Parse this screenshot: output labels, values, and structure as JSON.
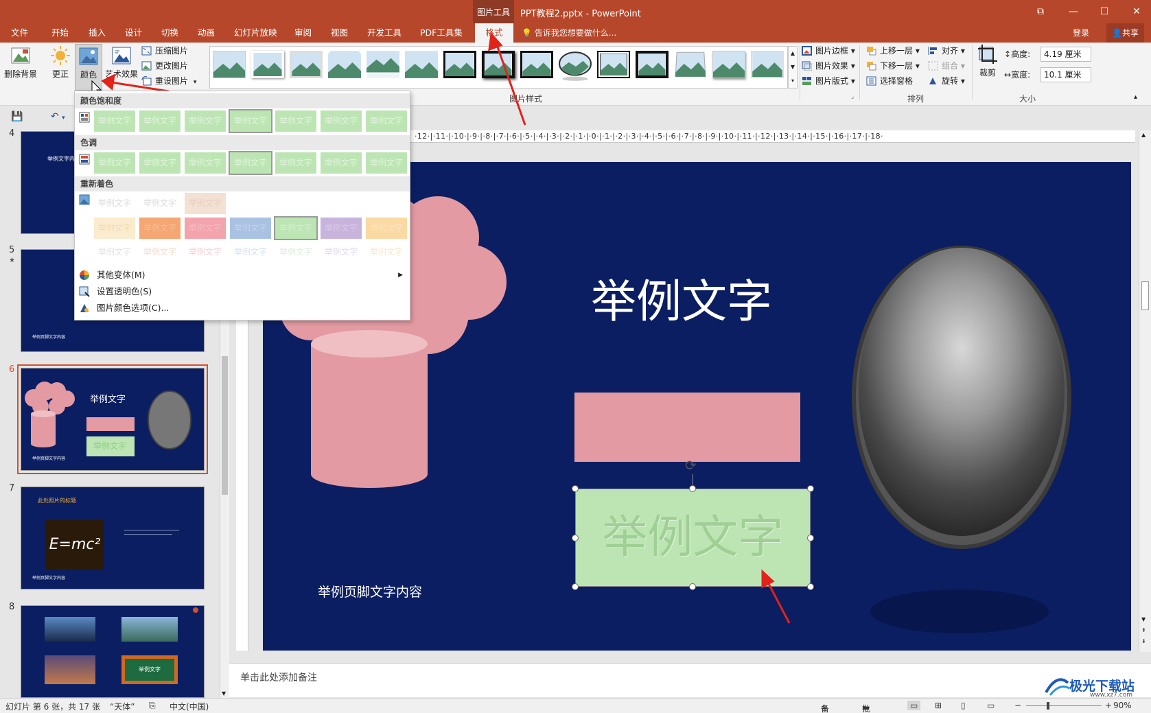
{
  "titlebar": {
    "contextual_group": "图片工具",
    "doc_title": "PPT教程2.pptx - PowerPoint",
    "win_restore": "⧉",
    "win_min": "—",
    "win_max": "☐",
    "win_close": "✕"
  },
  "tabs": [
    "文件",
    "开始",
    "插入",
    "设计",
    "切换",
    "动画",
    "幻灯片放映",
    "审阅",
    "视图",
    "开发工具",
    "PDF工具集",
    "格式"
  ],
  "active_tab": "格式",
  "tell_me": "告诉我您想要做什么...",
  "login": "登录",
  "share": "共享",
  "ribbon": {
    "remove_bg": "删除背景",
    "corrections": "更正",
    "color": "颜色",
    "artistic": "艺术效果",
    "compress": "压缩图片",
    "change": "更改图片",
    "reset": "重设图片",
    "picture_styles_label": "图片样式",
    "border": "图片边框",
    "effects": "图片效果",
    "layout": "图片版式",
    "bring_forward": "上移一层",
    "send_backward": "下移一层",
    "selection_pane": "选择窗格",
    "align": "对齐",
    "group": "组合",
    "rotate": "旋转",
    "arrange_label": "排列",
    "crop": "裁剪",
    "height_label": "高度:",
    "height_value": "4.19 厘米",
    "width_label": "宽度:",
    "width_value": "10.1 厘米",
    "size_label": "大小"
  },
  "color_menu": {
    "saturation_header": "颜色饱和度",
    "tone_header": "色调",
    "recolor_header": "重新着色",
    "swatch_text": "举例文字",
    "more_variations": "其他变体(M)",
    "set_transparent": "设置透明色(S)",
    "color_options": "图片颜色选项(C)..."
  },
  "slides": [
    {
      "num": "4",
      "text": "举例文字内容。"
    },
    {
      "num": "5",
      "star": "★",
      "footer": "举例页脚文字内容"
    },
    {
      "num": "6",
      "title": "举例文字",
      "box": "举例文字",
      "footer": "举例页脚文字内容"
    },
    {
      "num": "7",
      "title": "此处照片的标题",
      "footer": "举例页脚文字内容",
      "formula": "E=mc²"
    },
    {
      "num": "8",
      "badge": "举例文字"
    }
  ],
  "slide": {
    "title": "举例文字",
    "box_text": "举例文字",
    "footer": "举例页脚文字内容"
  },
  "hruler_text": "·12·|·11·|·10·|·9·|·8·|·7·|·6·|·5·|·4·|·3·|·2·|·1·|·0·|·1·|·2·|·3·|·4·|·5·|·6·|·7·|·8·|·9·|·10·|·11·|·12·|·13·|·14·|·15·|·16·|·17·|·18·",
  "notes_placeholder": "单击此处添加备注",
  "status": {
    "slide_info": "幻灯片 第 6 张，共 17 张",
    "theme": "“天体”",
    "language": "中文(中国)",
    "notes": "备注",
    "comments": "批注",
    "zoom": "90%"
  },
  "watermark": "极光下载站",
  "watermark_url": "www.xz7.com",
  "colors": {
    "accent": "#b7472a",
    "slide_bg": "#0b1e62",
    "pink": "#e39aa2",
    "green": "#bde5b4"
  }
}
